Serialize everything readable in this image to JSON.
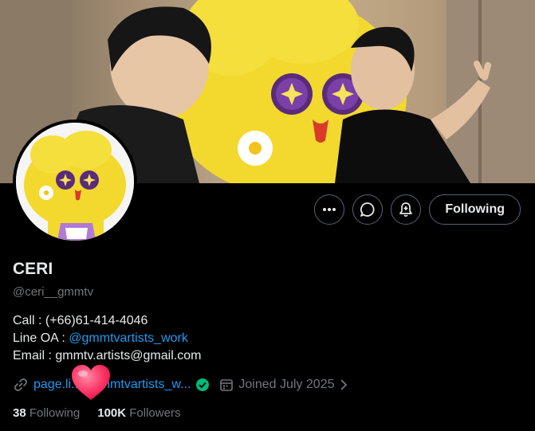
{
  "profile": {
    "name": "CERI",
    "handle": "@ceri__gmmtv",
    "bio": {
      "call_label": "Call : (+66)61-414-4046",
      "line_label": "Line OA : ",
      "line_link": "@gmmtvartists_work",
      "email_label": "Email : gmmtv.artists@gmail.com"
    },
    "website_text": "page.li...e/gmmtvartists_w...",
    "joined": "Joined July 2025",
    "following_count": "38",
    "following_label": "Following",
    "followers_count": "100K",
    "followers_label": "Followers"
  },
  "actions": {
    "follow_label": "Following",
    "more_icon": "more-icon",
    "message_icon": "message-icon",
    "notify_icon": "notification-bell-icon"
  },
  "colors": {
    "accent": "#1d9bf0",
    "background": "#000000",
    "muted": "#71767b",
    "verified": "#00ba7c",
    "mascot_yellow": "#f5df3c",
    "heart": "#ff3b6b"
  }
}
